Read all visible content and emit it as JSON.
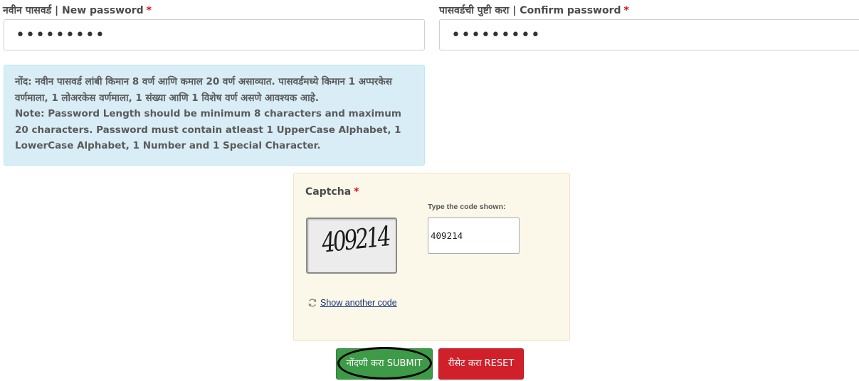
{
  "new_password": {
    "label": "नवीन पासवर्ड | New password",
    "required_mark": "*",
    "value": "•••••••••"
  },
  "confirm_password": {
    "label": "पासवर्डची पुष्टी करा | Confirm password",
    "required_mark": "*",
    "value": "•••••••••"
  },
  "note": {
    "marathi": "नोंद: नवीन पासवर्ड लांबी किमान 8 वर्ण आणि कमाल 20 वर्ण असाव्यात. पासवर्डमध्ये किमान 1 अप्परकेस वर्णमाला, 1 लोअरकेस वर्णमाला, 1 संख्या आणि 1 विशेष वर्ण असणे आवश्यक आहे.",
    "english": "Note: Password Length should be minimum 8 characters and maximum 20 characters. Password must contain atleast 1 UpperCase Alphabet, 1 LowerCase Alphabet, 1 Number and 1 Special Character."
  },
  "captcha": {
    "label": "Captcha",
    "required_mark": "*",
    "image_text": "409214",
    "type_label": "Type the code shown:",
    "input_value": "409214",
    "refresh_link": "Show another code",
    "refresh_icon": "refresh-icon"
  },
  "buttons": {
    "submit": "नोंदणी करा SUBMIT",
    "reset": "रीसेट करा RESET"
  },
  "colors": {
    "submit_bg": "#3d9a47",
    "reset_bg": "#d0202a",
    "note_bg": "#d9edf7",
    "captcha_bg": "#fcf8e9",
    "required": "#d6101b"
  }
}
